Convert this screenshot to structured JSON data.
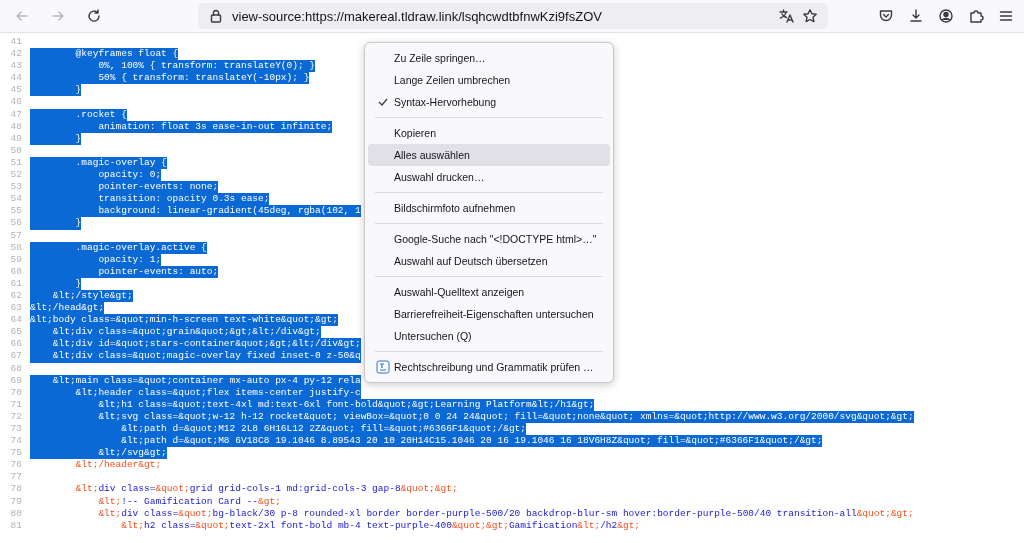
{
  "toolbar": {
    "back": {
      "disabled": true
    },
    "forward": {
      "disabled": true
    },
    "url": "view-source:https://makereal.tldraw.link/lsqhcwdtbfnwKzi9fsZOV"
  },
  "lines": [
    {
      "number": "41"
    },
    {
      "number": "42",
      "selected": true,
      "tokens": [
        {
          "text": "        @keyframes float {",
          "kind": "plain"
        }
      ]
    },
    {
      "number": "43",
      "selected": true,
      "tokens": [
        {
          "text": "            0%, 100% { transform: translateY(0); }",
          "kind": "plain"
        }
      ]
    },
    {
      "number": "44",
      "selected": true,
      "tokens": [
        {
          "text": "            50% { transform: translateY(-10px); }",
          "kind": "plain"
        }
      ]
    },
    {
      "number": "45",
      "selected": true,
      "tokens": [
        {
          "text": "        }",
          "kind": "plain"
        }
      ]
    },
    {
      "number": "46"
    },
    {
      "number": "47",
      "selected": true,
      "tokens": [
        {
          "text": "        .rocket {",
          "kind": "plain"
        }
      ]
    },
    {
      "number": "48",
      "selected": true,
      "tokens": [
        {
          "text": "            animation: float 3s ease-in-out infinite;",
          "kind": "plain"
        }
      ]
    },
    {
      "number": "49",
      "selected": true,
      "tokens": [
        {
          "text": "        }",
          "kind": "plain"
        }
      ]
    },
    {
      "number": "50"
    },
    {
      "number": "51",
      "selected": true,
      "tokens": [
        {
          "text": "        .magic-overlay {",
          "kind": "plain"
        }
      ]
    },
    {
      "number": "52",
      "selected": true,
      "tokens": [
        {
          "text": "            opacity: 0;",
          "kind": "plain"
        }
      ]
    },
    {
      "number": "53",
      "selected": true,
      "tokens": [
        {
          "text": "            pointer-events: none;",
          "kind": "plain"
        }
      ]
    },
    {
      "number": "54",
      "selected": true,
      "tokens": [
        {
          "text": "            transition: opacity 0.3s ease;",
          "kind": "plain"
        }
      ]
    },
    {
      "number": "55",
      "selected": true,
      "tokens": [
        {
          "text": "            background: linear-gradient(45deg, rgba(102, 1",
          "kind": "plain"
        }
      ]
    },
    {
      "number": "56",
      "selected": true,
      "tokens": [
        {
          "text": "        }",
          "kind": "plain"
        }
      ]
    },
    {
      "number": "57"
    },
    {
      "number": "58",
      "selected": true,
      "tokens": [
        {
          "text": "        .magic-overlay.active {",
          "kind": "plain"
        }
      ]
    },
    {
      "number": "59",
      "selected": true,
      "tokens": [
        {
          "text": "            opacity: 1;",
          "kind": "plain"
        }
      ]
    },
    {
      "number": "60",
      "selected": true,
      "tokens": [
        {
          "text": "            pointer-events: auto;",
          "kind": "plain"
        }
      ]
    },
    {
      "number": "61",
      "selected": true,
      "tokens": [
        {
          "text": "        }",
          "kind": "plain"
        }
      ]
    },
    {
      "number": "62",
      "selected": true,
      "tokens": [
        {
          "text": "    &lt;/style&gt;",
          "kind": "plain"
        }
      ]
    },
    {
      "number": "63",
      "selected": true,
      "tokens": [
        {
          "text": "&lt;/head&gt;",
          "kind": "plain"
        }
      ]
    },
    {
      "number": "64",
      "selected": true,
      "tokens": [
        {
          "text": "&lt;body class=&quot;min-h-screen text-white&quot;&gt;",
          "kind": "plain"
        }
      ]
    },
    {
      "number": "65",
      "selected": true,
      "tokens": [
        {
          "text": "    &lt;div class=&quot;grain&quot;&gt;&lt;/div&gt;",
          "kind": "plain"
        }
      ]
    },
    {
      "number": "66",
      "selected": true,
      "tokens": [
        {
          "text": "    &lt;div id=&quot;stars-container&quot;&gt;&lt;/div&gt;",
          "kind": "plain"
        }
      ]
    },
    {
      "number": "67",
      "selected": true,
      "tokens": [
        {
          "text": "    &lt;div class=&quot;magic-overlay fixed inset-0 z-50&q",
          "kind": "plain"
        }
      ]
    },
    {
      "number": "68"
    },
    {
      "number": "69",
      "selected": true,
      "tokens": [
        {
          "text": "    &lt;main class=&quot;container mx-auto px-4 py-12 rela",
          "kind": "plain"
        }
      ]
    },
    {
      "number": "70",
      "selected": true,
      "tokens": [
        {
          "text": "        &lt;header class=&quot;flex items-center justify-c",
          "kind": "plain"
        }
      ]
    },
    {
      "number": "71",
      "selected": true,
      "tokens": [
        {
          "text": "            &lt;h1 class=&quot;text-4xl md:text-6xl font-bold&quot;&gt;Learning Platform&lt;/h1&gt;",
          "kind": "plain"
        }
      ]
    },
    {
      "number": "72",
      "selected": true,
      "tokens": [
        {
          "text": "            &lt;svg class=&quot;w-12 h-12 rocket&quot; viewBox=&quot;0 0 24 24&quot; fill=&quot;none&quot; xmlns=&quot;http://www.w3.org/2000/svg&quot;&gt;",
          "kind": "plain"
        }
      ]
    },
    {
      "number": "73",
      "selected": true,
      "tokens": [
        {
          "text": "                &lt;path d=&quot;M12 2L8 6H16L12 2Z&quot; fill=&quot;#6366F1&quot;/&gt;",
          "kind": "plain"
        }
      ]
    },
    {
      "number": "74",
      "selected": true,
      "tokens": [
        {
          "text": "                &lt;path d=&quot;M8 6V18C8 19.1046 8.89543 20 10 20H14C15.1046 20 16 19.1046 16 18V6H8Z&quot; fill=&quot;#6366F1&quot;/&gt;",
          "kind": "plain"
        }
      ]
    },
    {
      "number": "75",
      "selected": true,
      "tokens": [
        {
          "text": "            &lt;/svg&gt;",
          "kind": "plain"
        }
      ]
    },
    {
      "number": "76",
      "selected": false,
      "tokens": [
        {
          "text": "        &lt;/header&gt;",
          "kind": "markup"
        }
      ]
    },
    {
      "number": "77"
    },
    {
      "number": "78",
      "selected": false,
      "tokens": [
        {
          "text": "        &lt;",
          "kind": "markup"
        },
        {
          "text": "div class=",
          "kind": "plain"
        },
        {
          "text": "&quot;",
          "kind": "markup"
        },
        {
          "text": "grid grid-cols-1 md:grid-cols-3 gap-8",
          "kind": "plain"
        },
        {
          "text": "&quot;&gt;",
          "kind": "markup"
        }
      ]
    },
    {
      "number": "79",
      "selected": false,
      "tokens": [
        {
          "text": "            &lt;",
          "kind": "markup"
        },
        {
          "text": "!-- Gamification Card --",
          "kind": "plain"
        },
        {
          "text": "&gt;",
          "kind": "markup"
        }
      ]
    },
    {
      "number": "80",
      "selected": false,
      "tokens": [
        {
          "text": "            &lt;",
          "kind": "markup"
        },
        {
          "text": "div class=",
          "kind": "plain"
        },
        {
          "text": "&quot;",
          "kind": "markup"
        },
        {
          "text": "bg-black/30 p-8 rounded-xl border border-purple-500/20 backdrop-blur-sm hover:border-purple-500/40 transition-all",
          "kind": "plain"
        },
        {
          "text": "&quot;&gt;",
          "kind": "markup"
        }
      ]
    },
    {
      "number": "81",
      "selected": false,
      "tokens": [
        {
          "text": "                &lt;",
          "kind": "markup"
        },
        {
          "text": "h2 class=",
          "kind": "plain"
        },
        {
          "text": "&quot;",
          "kind": "markup"
        },
        {
          "text": "text-2xl font-bold mb-4 text-purple-400",
          "kind": "plain"
        },
        {
          "text": "&quot;&gt;",
          "kind": "markup"
        },
        {
          "text": "Gamification",
          "kind": "plain"
        },
        {
          "text": "&lt;",
          "kind": "markup"
        },
        {
          "text": "/h2",
          "kind": "plain"
        },
        {
          "text": "&gt;",
          "kind": "markup"
        }
      ]
    }
  ],
  "context_menu": {
    "items": [
      {
        "kind": "item",
        "label": "Zu Zeile springen…",
        "checked": false,
        "selected": false
      },
      {
        "kind": "item",
        "label": "Lange Zeilen umbrechen",
        "checked": false,
        "selected": false
      },
      {
        "kind": "item",
        "label": "Syntax-Hervorhebung",
        "checked": true,
        "selected": false
      },
      {
        "kind": "separator"
      },
      {
        "kind": "item",
        "label": "Kopieren",
        "checked": false,
        "selected": false
      },
      {
        "kind": "item",
        "label": "Alles auswählen",
        "checked": false,
        "selected": true
      },
      {
        "kind": "item",
        "label": "Auswahl drucken…",
        "checked": false,
        "selected": false
      },
      {
        "kind": "separator"
      },
      {
        "kind": "item",
        "label": "Bildschirmfoto aufnehmen",
        "checked": false,
        "selected": false
      },
      {
        "kind": "separator"
      },
      {
        "kind": "item",
        "label": "Google-Suche nach \"<!DOCTYPE html>…\"",
        "checked": false,
        "selected": false
      },
      {
        "kind": "item",
        "label": "Auswahl auf Deutsch übersetzen",
        "checked": false,
        "selected": false
      },
      {
        "kind": "separator"
      },
      {
        "kind": "item",
        "label": "Auswahl-Quelltext anzeigen",
        "checked": false,
        "selected": false
      },
      {
        "kind": "item",
        "label": "Barrierefreiheit-Eigenschaften untersuchen",
        "checked": false,
        "selected": false
      },
      {
        "kind": "item",
        "label": "Untersuchen (Q)",
        "checked": false,
        "selected": false
      },
      {
        "kind": "separator"
      },
      {
        "kind": "extension",
        "label": "Rechtschreibung und Grammatik prüfen …",
        "selected": false
      }
    ]
  }
}
